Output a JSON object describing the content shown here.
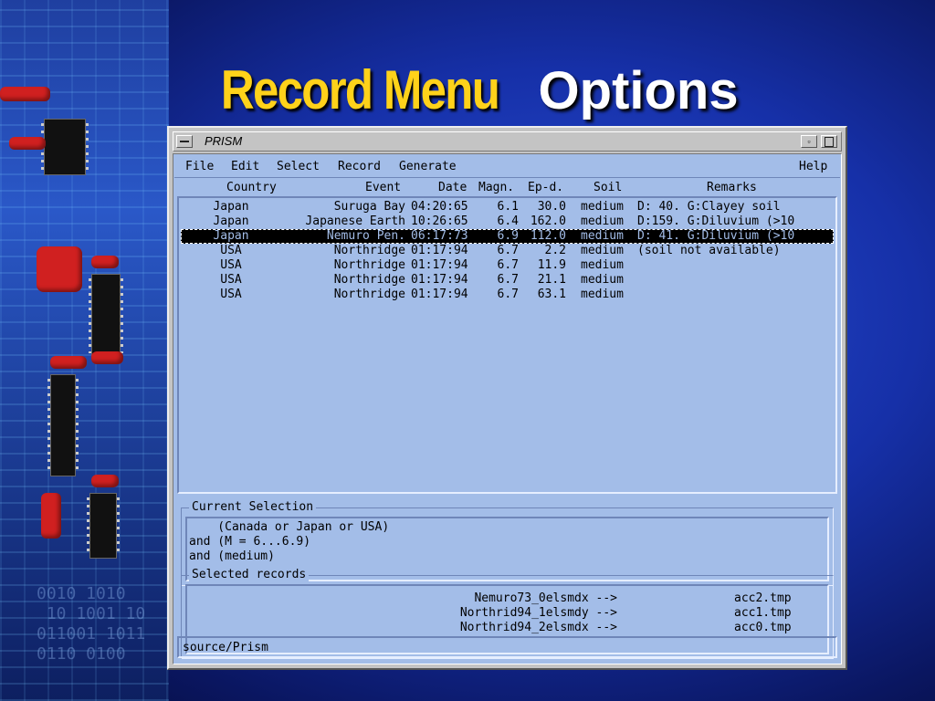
{
  "slide": {
    "title_part1": "Record Menu",
    "title_part2": "Options"
  },
  "window": {
    "title": "PRISM",
    "menu": [
      "File",
      "Edit",
      "Select",
      "Record",
      "Generate",
      "Help"
    ],
    "columns": {
      "country": "Country",
      "event": "Event",
      "date": "Date",
      "magn": "Magn.",
      "epd": "Ep-d.",
      "soil": "Soil",
      "remarks": "Remarks"
    },
    "records": [
      {
        "country": "Japan",
        "event": "Suruga Bay",
        "date": "04:20:65",
        "magn": "6.1",
        "epd": "30.0",
        "soil": "medium",
        "remarks": "D: 40. G:Clayey soil",
        "selected": false
      },
      {
        "country": "Japan",
        "event": "Japanese Earth",
        "date": "10:26:65",
        "magn": "6.4",
        "epd": "162.0",
        "soil": "medium",
        "remarks": "D:159. G:Diluvium (>10",
        "selected": false
      },
      {
        "country": "Japan",
        "event": "Nemuro Pen.",
        "date": "06:17:73",
        "magn": "6.9",
        "epd": "112.0",
        "soil": "medium",
        "remarks": "D: 41. G:Diluvium (>10",
        "selected": true
      },
      {
        "country": "USA",
        "event": "Northridge",
        "date": "01:17:94",
        "magn": "6.7",
        "epd": "2.2",
        "soil": "medium",
        "remarks": "(soil not available)",
        "selected": false
      },
      {
        "country": "USA",
        "event": "Northridge",
        "date": "01:17:94",
        "magn": "6.7",
        "epd": "11.9",
        "soil": "medium",
        "remarks": "",
        "selected": false
      },
      {
        "country": "USA",
        "event": "Northridge",
        "date": "01:17:94",
        "magn": "6.7",
        "epd": "21.1",
        "soil": "medium",
        "remarks": "",
        "selected": false
      },
      {
        "country": "USA",
        "event": "Northridge",
        "date": "01:17:94",
        "magn": "6.7",
        "epd": "63.1",
        "soil": "medium",
        "remarks": "",
        "selected": false
      }
    ],
    "current_selection": {
      "label": "Current Selection",
      "lines": [
        "    (Canada or Japan or USA)",
        "and (M = 6...6.9)",
        "and (medium)"
      ]
    },
    "selected_records": {
      "label": "Selected records",
      "items": [
        {
          "source": "Nemuro73_0elsmdx -->",
          "target": "acc2.tmp"
        },
        {
          "source": "Northrid94_1elsmdy -->",
          "target": "acc1.tmp"
        },
        {
          "source": "Northrid94_2elsmdx -->",
          "target": "acc0.tmp"
        }
      ]
    },
    "status": "source/Prism"
  }
}
